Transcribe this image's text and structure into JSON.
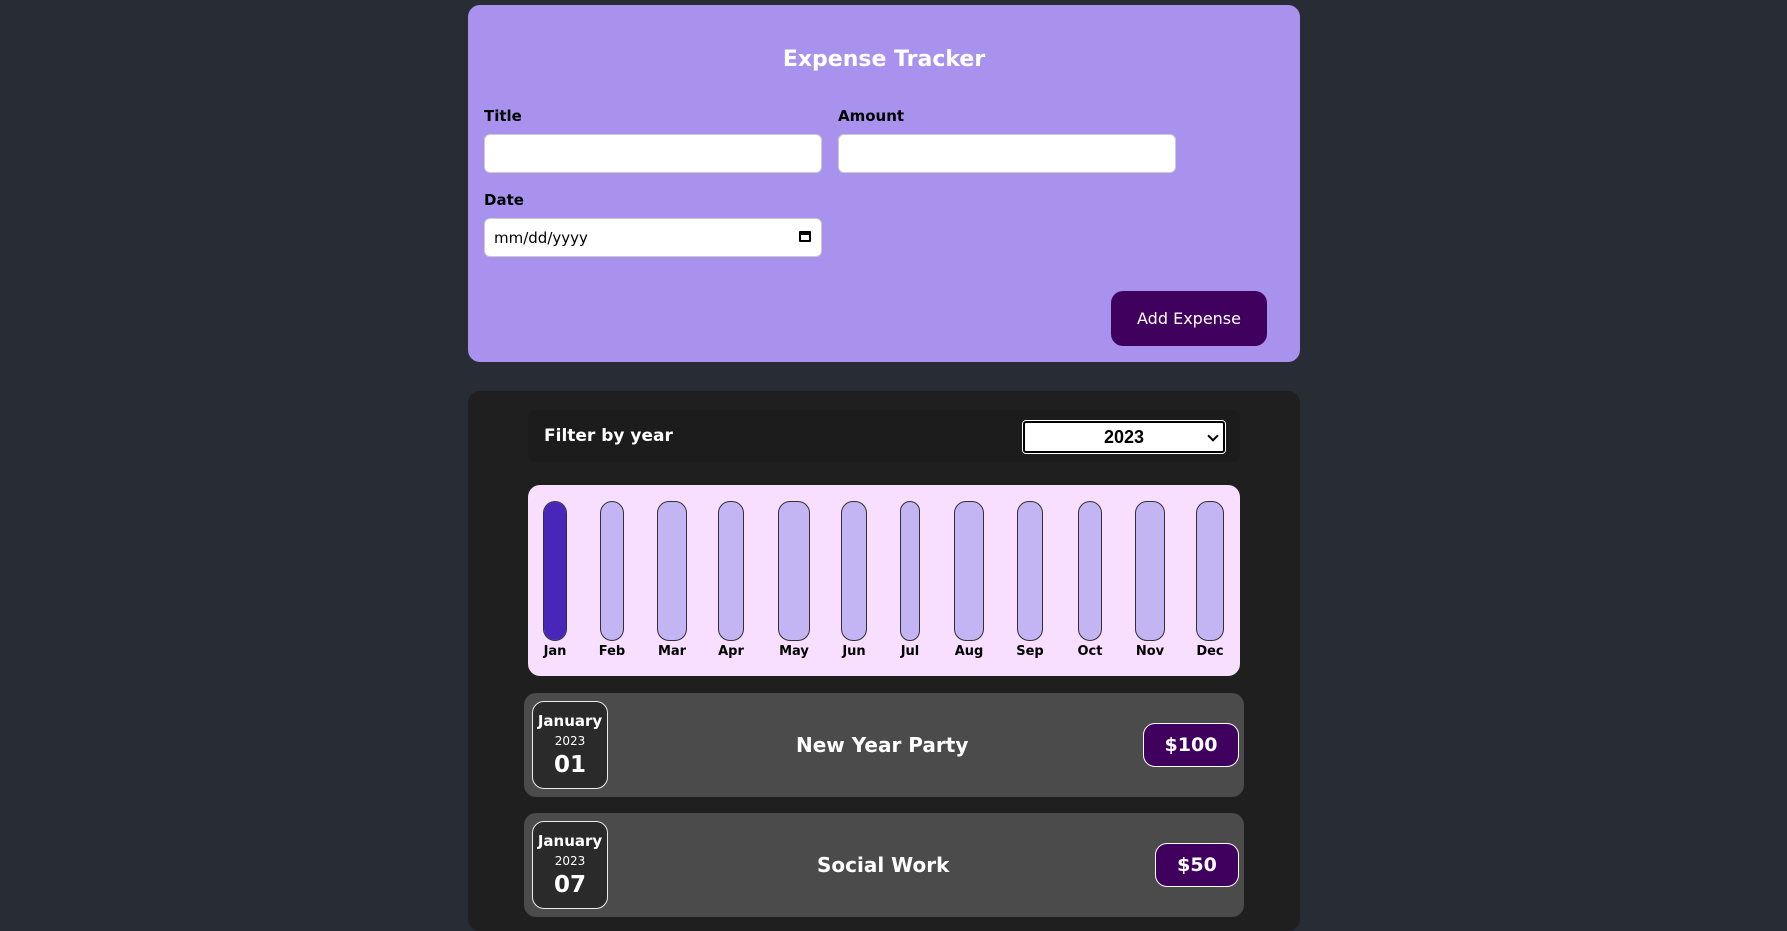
{
  "form": {
    "title": "Expense Tracker",
    "title_label": "Title",
    "title_value": "",
    "amount_label": "Amount",
    "amount_value": "",
    "date_label": "Date",
    "date_placeholder": "mm/dd/yyyy",
    "date_icon": "calendar-icon",
    "submit_label": "Add Expense"
  },
  "filter": {
    "label": "Filter by year",
    "selected_year": "2023",
    "chevron_icon": "chevron-down-icon"
  },
  "chart_data": {
    "type": "bar",
    "categories": [
      "Jan",
      "Feb",
      "Mar",
      "Apr",
      "May",
      "Jun",
      "Jul",
      "Aug",
      "Sep",
      "Oct",
      "Nov",
      "Dec"
    ],
    "values": [
      150,
      0,
      0,
      0,
      0,
      0,
      0,
      0,
      0,
      0,
      0,
      0
    ],
    "max_value": 150
  },
  "expenses": [
    {
      "month": "January",
      "year": "2023",
      "day": "01",
      "title": "New Year Party",
      "amount": "$100"
    },
    {
      "month": "January",
      "year": "2023",
      "day": "07",
      "title": "Social Work",
      "amount": "$50"
    }
  ],
  "colors": {
    "page_bg": "#282c34",
    "form_bg": "#a892ee",
    "button_bg": "#40005d",
    "list_bg": "#1f1f1f",
    "chart_bg": "#f8dfff",
    "bar_track": "#c3b4f3",
    "bar_fill": "#4826b9",
    "item_bg": "#4b4b4b"
  }
}
